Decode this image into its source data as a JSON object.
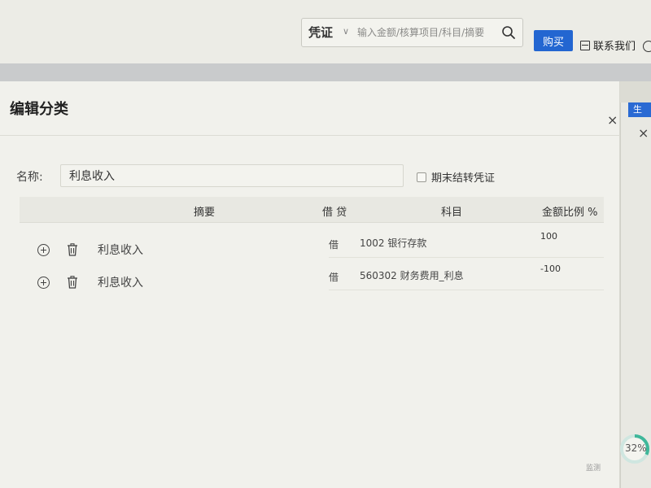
{
  "topbar": {
    "search": {
      "type_label": "凭证",
      "placeholder": "输入金额/核算项目/科目/摘要"
    },
    "buy_label": "购买",
    "contact_label": "联系我们"
  },
  "background": {
    "tab_label": "生"
  },
  "dialog": {
    "title": "编辑分类",
    "name_label": "名称:",
    "name_value": "利息收入",
    "period_end_label": "期末结转凭证",
    "period_end_checked": false,
    "columns": {
      "summary": "摘要",
      "debit_credit": "借 贷",
      "subject": "科目",
      "ratio": "金额比例 %"
    },
    "rows": [
      {
        "summary": "利息收入",
        "debit_credit": "借",
        "subject": "1002 银行存款",
        "ratio": "100"
      },
      {
        "summary": "利息收入",
        "debit_credit": "借",
        "subject": "560302 财务费用_利息",
        "ratio": "-100"
      }
    ]
  },
  "progress": {
    "value_label": "32%",
    "value": 0.32
  },
  "footer_note": "监测"
}
